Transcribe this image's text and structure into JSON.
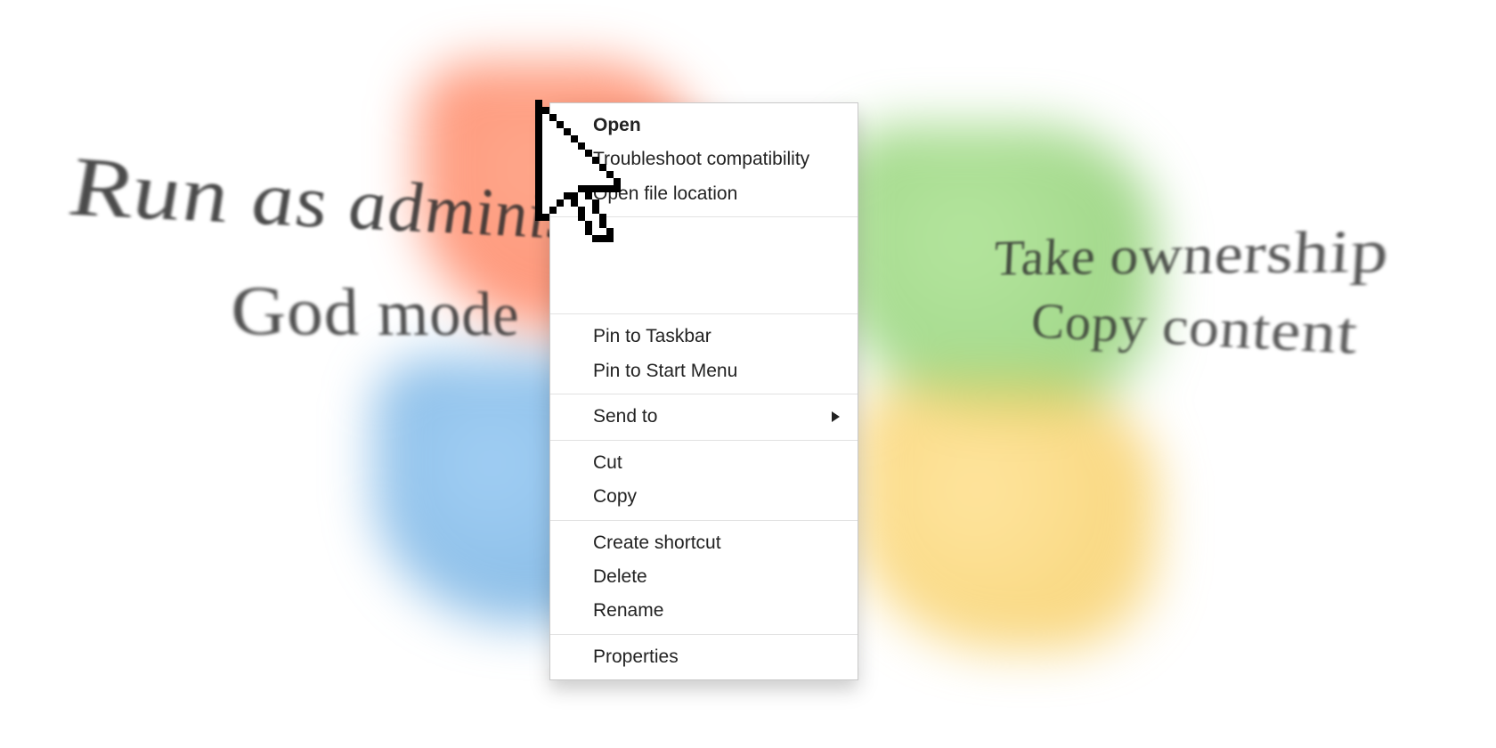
{
  "bgText": {
    "runAsAdmin": "Run as administrator",
    "godMode": "God mode",
    "takeOwnership": "Take ownership",
    "copyContent": "Copy content"
  },
  "contextMenu": {
    "open": "Open",
    "troubleshoot": "Troubleshoot compatibility",
    "openFileLocation": "Open file location",
    "pinTaskbar": "Pin to Taskbar",
    "pinStartMenu": "Pin to Start Menu",
    "sendTo": "Send to",
    "cut": "Cut",
    "copy": "Copy",
    "createShortcut": "Create shortcut",
    "delete": "Delete",
    "rename": "Rename",
    "properties": "Properties"
  }
}
